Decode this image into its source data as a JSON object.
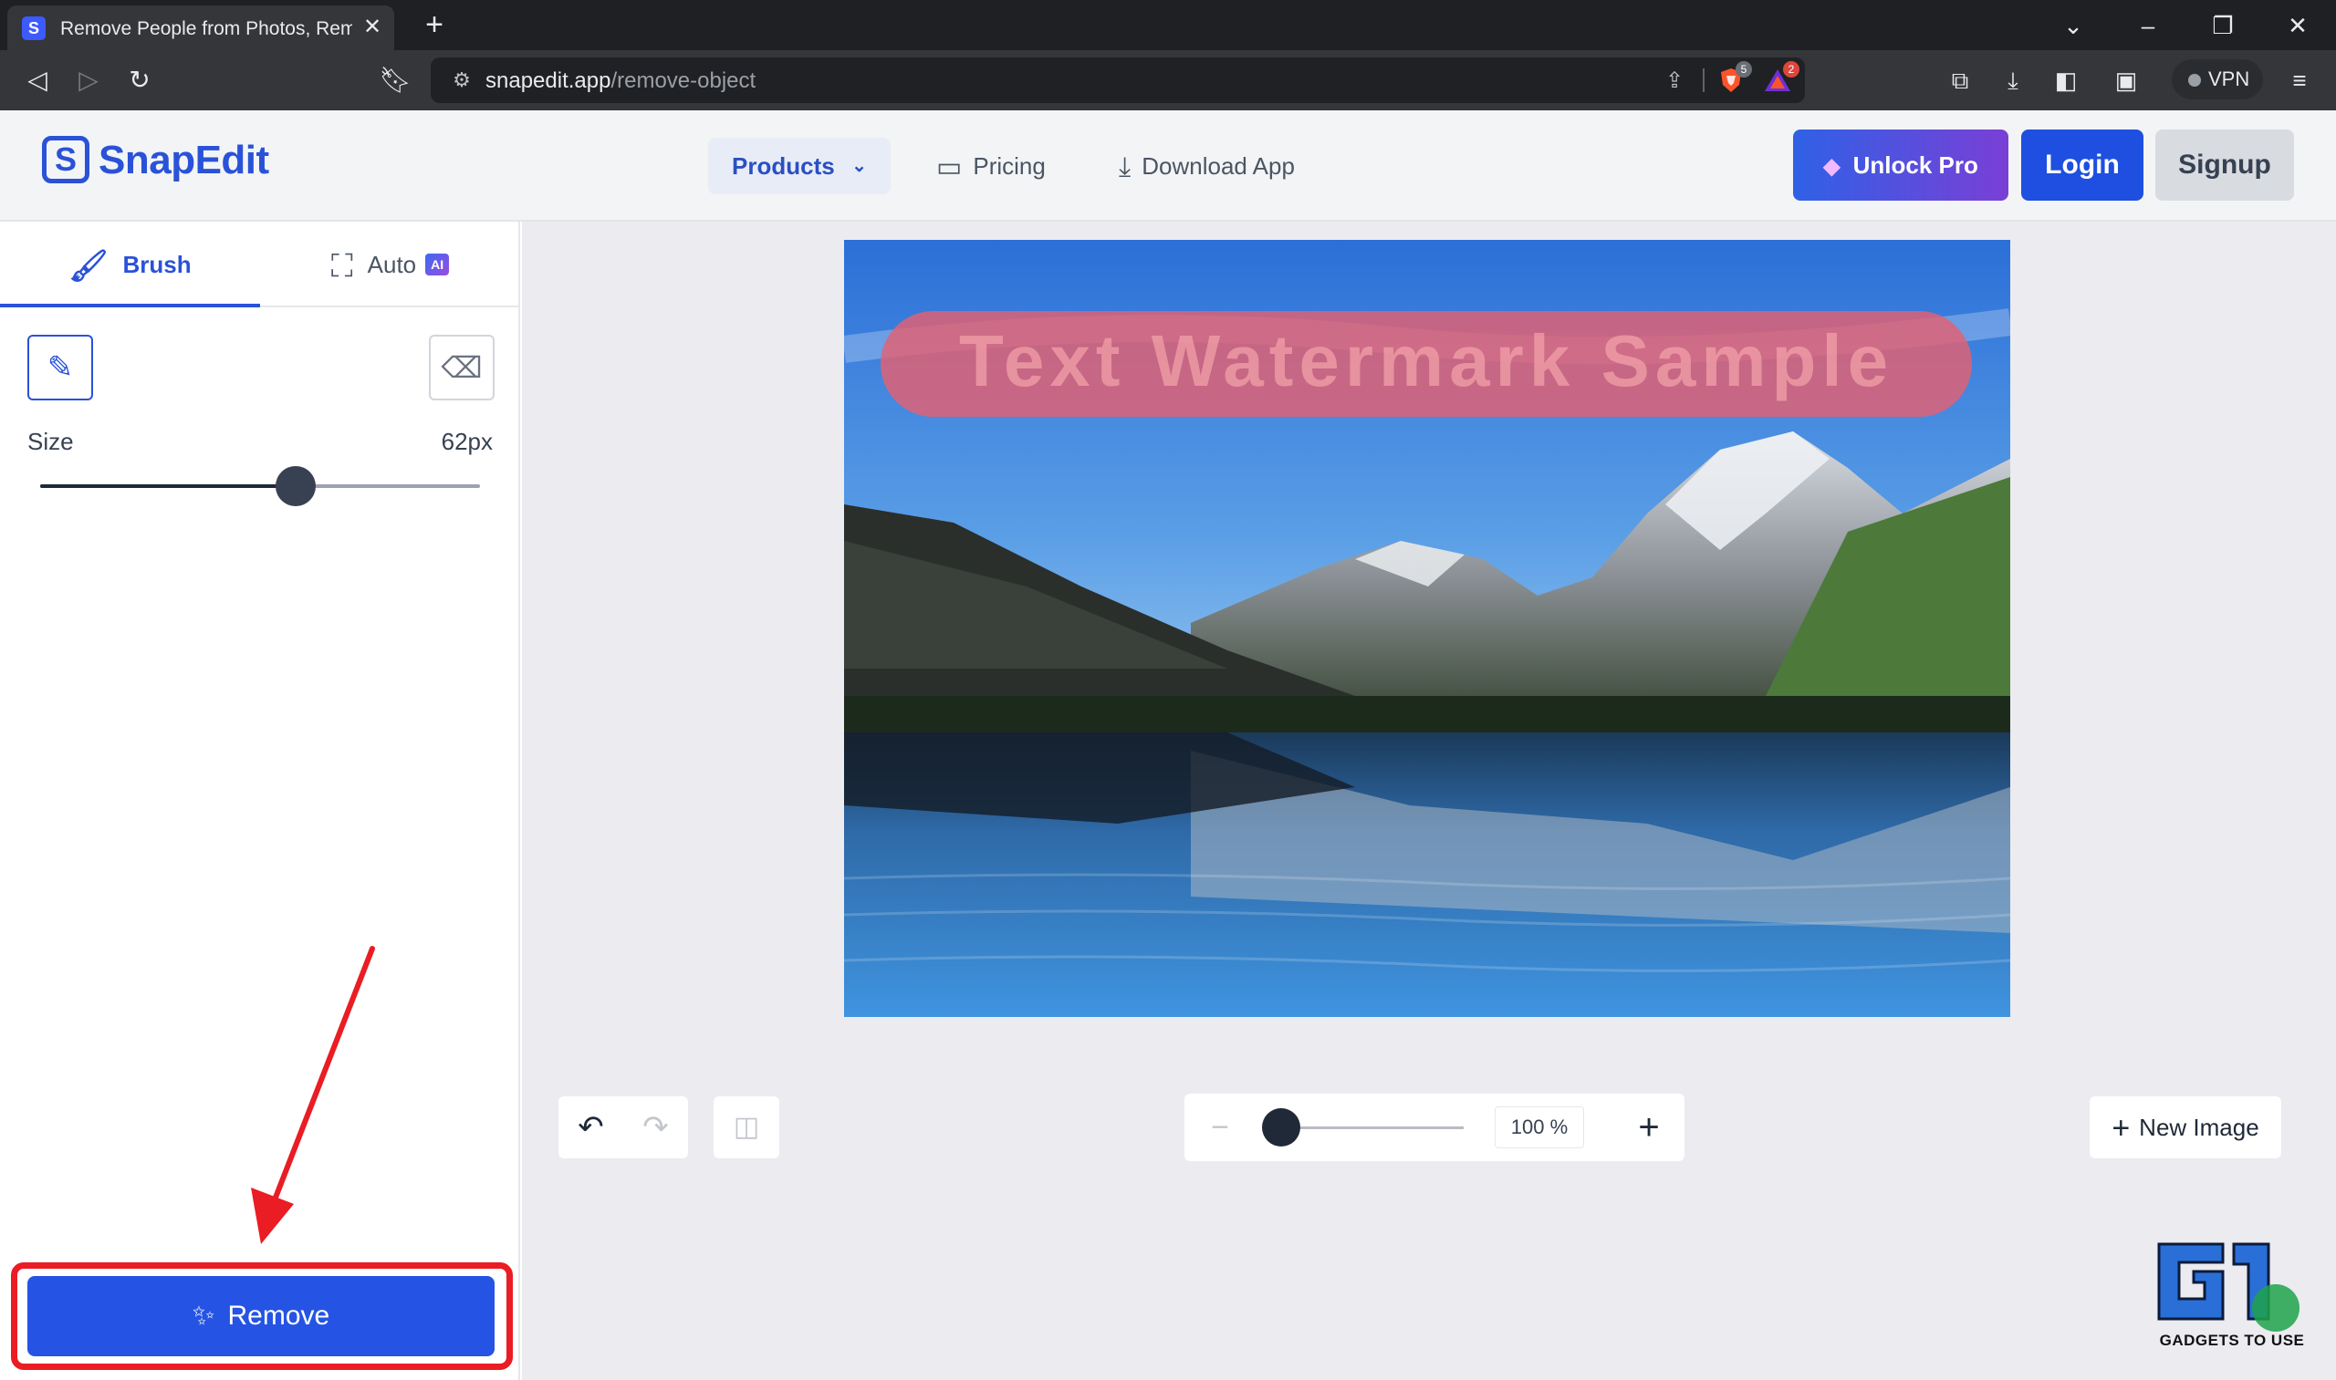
{
  "browser": {
    "tab_title": "Remove People from Photos, Remove Objects",
    "favicon_glyph": "S",
    "url_host": "snapedit.app",
    "url_path": "/remove-object",
    "brave_badge": "5",
    "rewards_badge": "2",
    "vpn_label": "VPN"
  },
  "header": {
    "logo_text": "SnapEdit",
    "logo_glyph": "S",
    "nav_products": "Products",
    "nav_pricing": "Pricing",
    "nav_download": "Download App",
    "unlock_label": "Unlock Pro",
    "login_label": "Login",
    "signup_label": "Signup"
  },
  "tools": {
    "tab_brush": "Brush",
    "tab_auto": "Auto",
    "ai_badge": "AI",
    "size_label": "Size",
    "size_value": "62px",
    "size_fraction": 0.58,
    "remove_label": "Remove"
  },
  "canvas": {
    "watermark_text": "Text Watermark Sample",
    "zoom_value": "100 %",
    "zoom_fraction": 0.0,
    "new_image_label": "New Image"
  },
  "overlay": {
    "brand_watermark": "GADGETS TO USE"
  },
  "colors": {
    "brand_blue": "#2a52d8",
    "highlight_red": "#ea1c24",
    "mask_red": "#e46072"
  },
  "icons": [
    "back-icon",
    "forward-icon",
    "reload-icon",
    "bookmark-icon",
    "site-info-icon",
    "share-icon",
    "brave-shield-icon",
    "rewards-icon",
    "extensions-icon",
    "download-icon",
    "sidebar-icon",
    "wallet-icon",
    "menu-icon",
    "chevron-down-icon",
    "pricing-card-icon",
    "download-app-icon",
    "gem-icon",
    "brush-icon",
    "auto-select-icon",
    "brush-mode-icon",
    "eraser-icon",
    "magic-wand-icon",
    "undo-icon",
    "redo-icon",
    "compare-icon",
    "minus-icon",
    "plus-icon"
  ]
}
